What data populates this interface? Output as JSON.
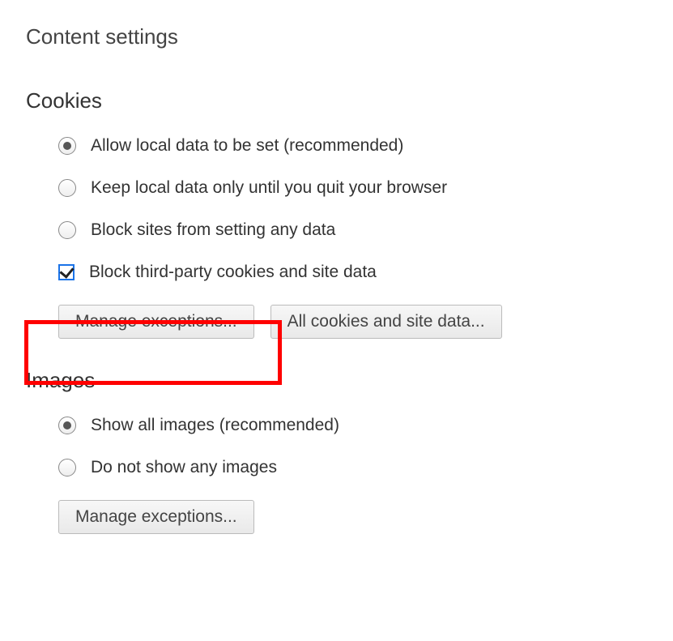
{
  "page_title": "Content settings",
  "cookies": {
    "title": "Cookies",
    "options": {
      "allow": "Allow local data to be set (recommended)",
      "keep_until_quit": "Keep local data only until you quit your browser",
      "block_all": "Block sites from setting any data",
      "block_third_party": "Block third-party cookies and site data"
    },
    "buttons": {
      "manage_exceptions": "Manage exceptions...",
      "all_cookies": "All cookies and site data..."
    },
    "selected": "allow",
    "block_third_party_checked": true
  },
  "images": {
    "title": "Images",
    "options": {
      "show_all": "Show all images (recommended)",
      "do_not_show": "Do not show any images"
    },
    "buttons": {
      "manage_exceptions": "Manage exceptions..."
    },
    "selected": "show_all"
  }
}
